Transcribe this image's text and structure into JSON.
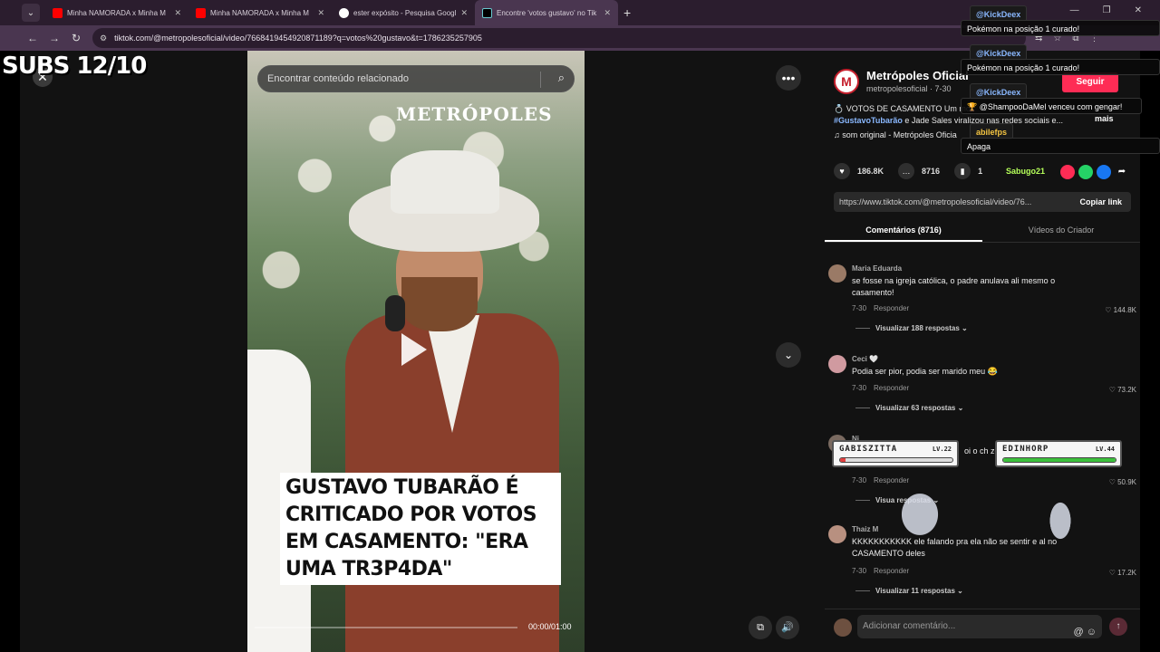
{
  "browser": {
    "tabs": [
      {
        "title": "Minha NAMORADA x Minha M",
        "icon": "youtube-icon"
      },
      {
        "title": "Minha NAMORADA x Minha M",
        "icon": "youtube-icon"
      },
      {
        "title": "ester expósito - Pesquisa Googl",
        "icon": "google-icon"
      },
      {
        "title": "Encontre 'votos gustavo' no Tik",
        "icon": "tiktok-icon",
        "active": true
      }
    ],
    "url": "tiktok.com/@metropolesoficial/video/7668419454920871189?q=votos%20gustavo&t=1786235257905"
  },
  "overlay": {
    "subs": "SUBS 12/10"
  },
  "video": {
    "search_placeholder": "Encontrar conteúdo relacionado",
    "logo": "METRÓPOLES",
    "caption": "GUSTAVO TUBARÃO É CRITICADO POR VOTOS EM CASAMENTO: \"ERA UMA TR3P4DA\"",
    "time": "00:00/01:00",
    "progress": 0
  },
  "post": {
    "author": "Metrópoles Oficial",
    "handle": "metropolesoficial · 7-30",
    "follow_label": "Seguir",
    "desc_prefix": "💍 VOTOS DE CASAMENTO Um mo",
    "hashtag": "#GustavoTubarão",
    "desc_suffix": " e Jade Sales viralizou nas redes sociais e...",
    "more_label": "mais",
    "music": "♫  som original - Metrópoles Oficia",
    "likes": "186.8K",
    "comments": "8716",
    "saves": "1",
    "link": "https://www.tiktok.com/@metropolesoficial/video/76...",
    "copy_label": "Copiar link",
    "tab_comments": "Comentários (8716)",
    "tab_creator": "Vídeos do Criador"
  },
  "comments": [
    {
      "user": "Maria Eduarda",
      "text": "se fosse na igreja católica, o padre anulava ali mesmo o casamento!",
      "date": "7-30",
      "reply": "Responder",
      "likes": "♡ 144.8K",
      "view": "Visualizar 188 respostas ⌄"
    },
    {
      "user": "Ceci 🤍",
      "text": "Podia ser pior, podia ser marido meu 😂",
      "date": "7-30",
      "reply": "Responder",
      "likes": "♡ 73.2K",
      "view": "Visualizar 63 respostas ⌄"
    },
    {
      "user": "Ni",
      "text": "oi o ch              ze dess",
      "date": "7-30",
      "reply": "Responder",
      "likes": "♡ 50.9K",
      "view": "Visua            respostas ⌄"
    },
    {
      "user": "Thaiz M",
      "text": "KKKKKKKKKKK ele falando pra ela não se sentir e         al no CASAMENTO deles",
      "date": "7-30",
      "reply": "Responder",
      "likes": "♡ 17.2K",
      "view": "Visualizar 11 respostas ⌄"
    }
  ],
  "comment_input": {
    "placeholder": "Adicionar comentário..."
  },
  "chat": [
    {
      "name": "@KickDeex",
      "msg": "Pokémon na posição 1 curado!"
    },
    {
      "name": "@KickDeex",
      "msg": "Pokémon na posição 1 curado!"
    },
    {
      "name": "@KickDeex",
      "msg": "🏆 @ShampooDaMel venceu com gengar!"
    },
    {
      "name": "abilefps",
      "msg": "Apaga"
    },
    {
      "name": "Sabugo21",
      "msg": ""
    }
  ],
  "battle": {
    "left": {
      "name": "GABISZITTA",
      "level": "LV.22",
      "hp": 0.05
    },
    "right": {
      "name": "EDINHORP",
      "level": "LV.44",
      "hp": 1.0
    }
  },
  "colors": {
    "brand": "#fe2c55",
    "hashtag": "#8ab8ff",
    "hp_low": "#e04040",
    "hp_full": "#3cc03c"
  }
}
